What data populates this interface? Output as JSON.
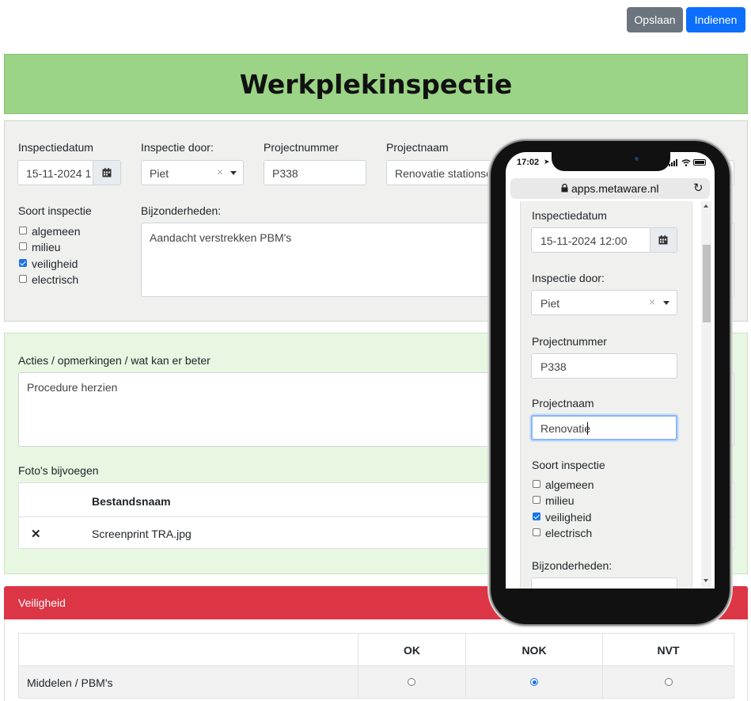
{
  "toolbar": {
    "save_label": "Opslaan",
    "submit_label": "Indienen"
  },
  "page_title": "Werkplekinspectie",
  "form": {
    "date_label": "Inspectiedatum",
    "date_value": "15-11-2024 1",
    "inspector_label": "Inspectie door:",
    "inspector_value": "Piet",
    "clear_symbol": "×",
    "project_number_label": "Projectnummer",
    "project_number_value": "P338",
    "project_name_label": "Projectnaam",
    "project_name_value": "Renovatie stationsen",
    "type_label": "Soort inspectie",
    "types": [
      {
        "label": "algemeen",
        "checked": false
      },
      {
        "label": "milieu",
        "checked": false
      },
      {
        "label": "veiligheid",
        "checked": true
      },
      {
        "label": "electrisch",
        "checked": false
      }
    ],
    "details_label": "Bijzonderheden:",
    "details_value": "Aandacht verstrekken PBM's"
  },
  "actions": {
    "label": "Acties / opmerkingen / wat kan er beter",
    "value": "Procedure herzien",
    "photos_label": "Foto's bijvoegen",
    "file_column": "Bestandsnaam",
    "files": [
      {
        "name": "Screenprint TRA.jpg",
        "remove_symbol": "✕"
      }
    ]
  },
  "safety": {
    "header": "Veiligheid",
    "columns": [
      "OK",
      "NOK",
      "NVT"
    ],
    "rows": [
      {
        "label": "Middelen / PBM's",
        "selected": "NOK"
      }
    ]
  },
  "phone": {
    "time": "17:02",
    "url": "apps.metaware.nl",
    "date_label": "Inspectiedatum",
    "date_value": "15-11-2024 12:00",
    "inspector_label": "Inspectie door:",
    "inspector_value": "Piet",
    "project_number_label": "Projectnummer",
    "project_number_value": "P338",
    "project_name_label": "Projectnaam",
    "project_name_value": "Renovatie",
    "type_label": "Soort inspectie",
    "types": [
      {
        "label": "algemeen",
        "checked": false
      },
      {
        "label": "milieu",
        "checked": false
      },
      {
        "label": "veiligheid",
        "checked": true
      },
      {
        "label": "electrisch",
        "checked": false
      }
    ],
    "details_label": "Bijzonderheden:"
  },
  "colors": {
    "save": "#6c757d",
    "submit": "#0d6efd",
    "title_bg": "#9bd486",
    "safety_header": "#dc3545"
  }
}
